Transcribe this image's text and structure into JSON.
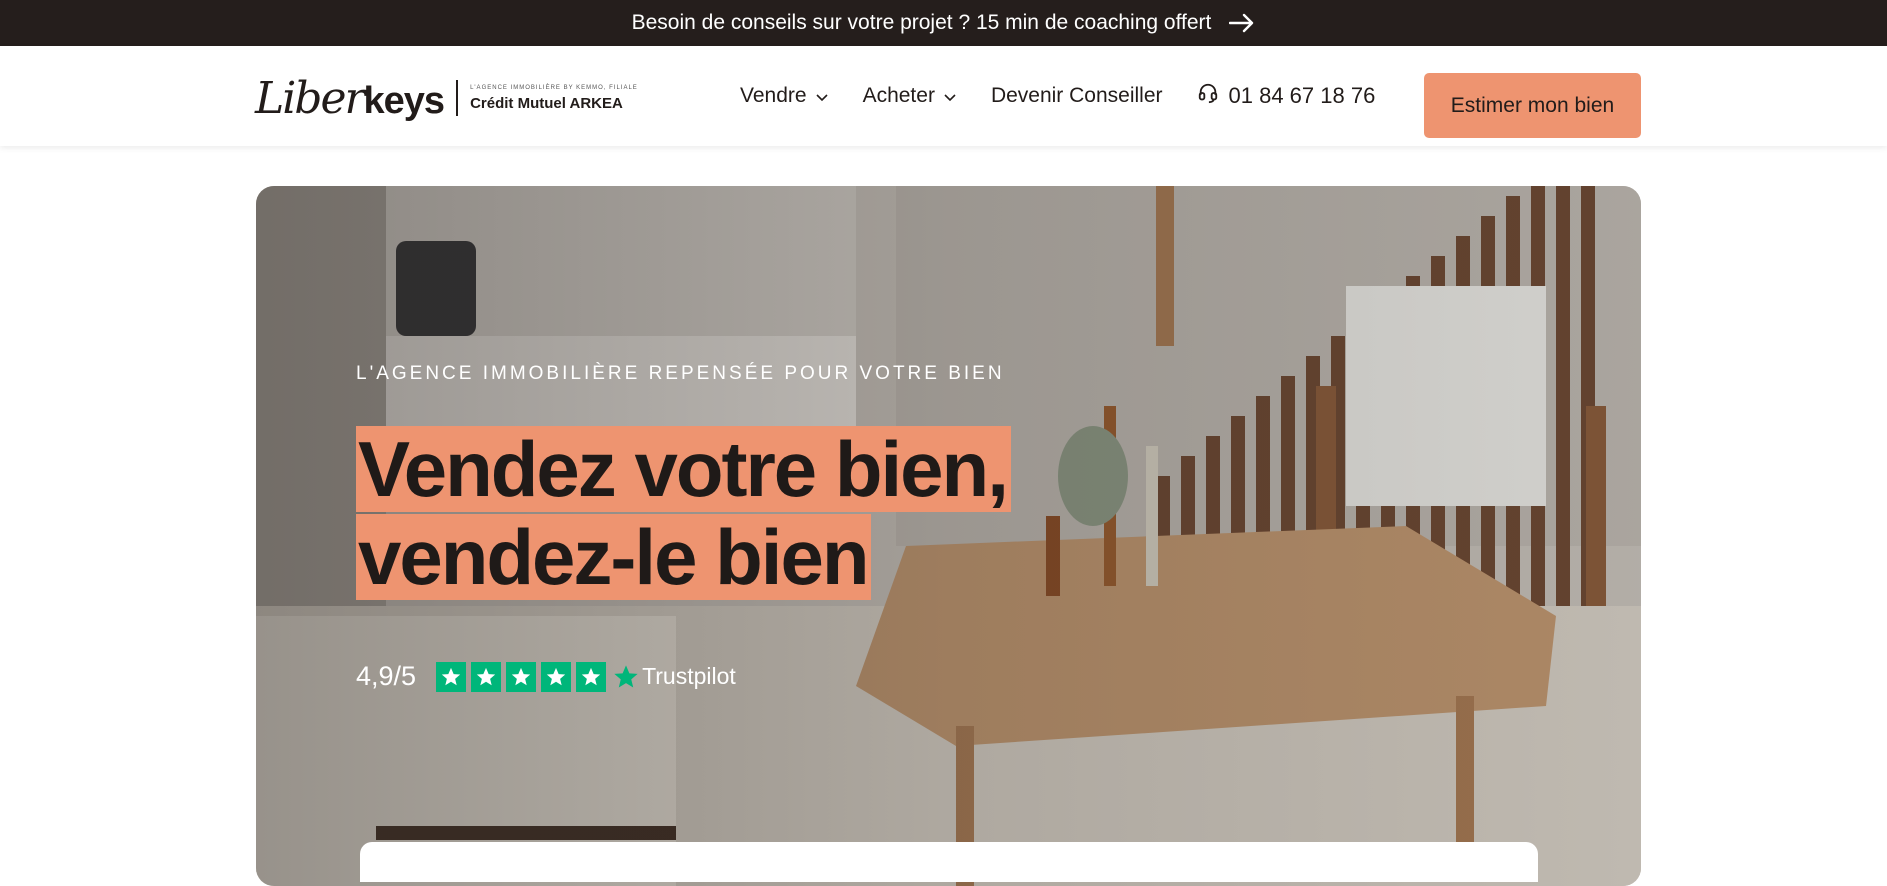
{
  "banner": {
    "text": "Besoin de conseils sur votre projet ? 15 min de coaching offert",
    "icon": "arrow-right-icon"
  },
  "logo": {
    "script": "Liber",
    "bold": "keys",
    "tagline": "L'AGENCE IMMOBILIÈRE BY KEMMO, FILIALE",
    "bank": "Crédit Mutuel ARKEA"
  },
  "nav": {
    "items": [
      {
        "label": "Vendre",
        "dropdown": true
      },
      {
        "label": "Acheter",
        "dropdown": true
      },
      {
        "label": "Devenir Conseiller",
        "dropdown": false
      }
    ],
    "phone": "01 84 67 18 76",
    "phone_icon": "headset-icon",
    "cta": "Estimer mon bien"
  },
  "hero": {
    "eyebrow": "L'AGENCE IMMOBILIÈRE REPENSÉE POUR VOTRE BIEN",
    "headline_line1": "Vendez votre bien,",
    "headline_line2": "vendez-le bien",
    "rating": "4,9/5",
    "stars": 5,
    "trustpilot": "Trustpilot"
  },
  "colors": {
    "accent": "#ee9470",
    "banner_bg": "#251e1c",
    "trustpilot_green": "#00b67a",
    "text_dark": "#221c1a"
  }
}
